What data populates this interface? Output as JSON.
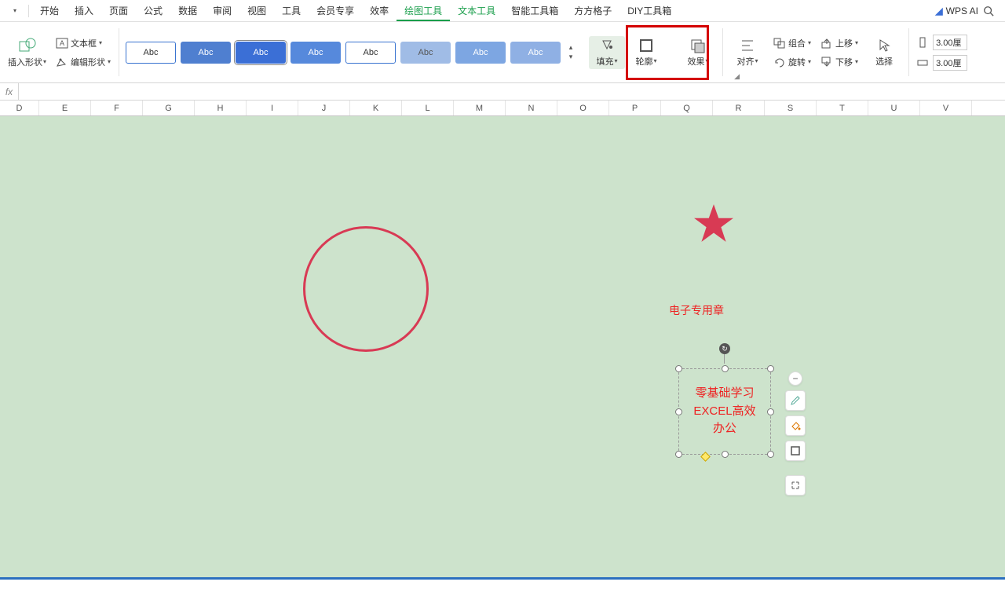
{
  "tabs": {
    "start": "开始",
    "insert": "插入",
    "page": "页面",
    "formula": "公式",
    "data": "数据",
    "review": "审阅",
    "view": "视图",
    "tools": "工具",
    "vip": "会员专享",
    "efficiency": "效率",
    "draw": "绘图工具",
    "text": "文本工具",
    "smart": "智能工具箱",
    "ffgz": "方方格子",
    "diy": "DIY工具箱",
    "wpsai": "WPS AI"
  },
  "ribbon": {
    "insert_shape": "插入形状",
    "textbox": "文本框",
    "edit_shape": "编辑形状",
    "style_label": "Abc",
    "fill": "填充",
    "outline": "轮廓",
    "effect": "效果",
    "align": "对齐",
    "group": "组合",
    "rotate": "旋转",
    "moveup": "上移",
    "movedown": "下移",
    "select": "选择",
    "dim1": "3.00厘",
    "dim2": "3.00厘"
  },
  "columns": [
    "D",
    "E",
    "F",
    "G",
    "H",
    "I",
    "J",
    "K",
    "L",
    "M",
    "N",
    "O",
    "P",
    "Q",
    "R",
    "S",
    "T",
    "U",
    "V"
  ],
  "canvas": {
    "stamp_label": "电子专用章",
    "textbox_line1": "零基础学习",
    "textbox_line2": "EXCEL高效",
    "textbox_line3": "办公"
  }
}
